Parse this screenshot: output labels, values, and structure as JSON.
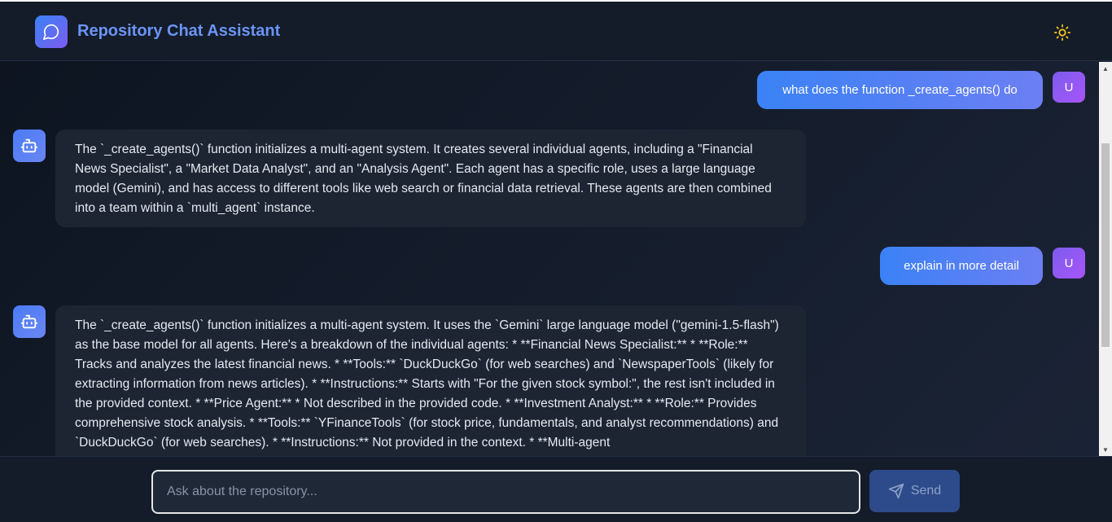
{
  "header": {
    "title": "Repository Chat Assistant",
    "theme_toggle_icon": "sun-icon"
  },
  "messages": [
    {
      "role": "user",
      "avatar": "U",
      "text": "what does the function _create_agents() do"
    },
    {
      "role": "assistant",
      "text": "The `_create_agents()` function initializes a multi-agent system. It creates several individual agents, including a \"Financial News Specialist\", a \"Market Data Analyst\", and an \"Analysis Agent\". Each agent has a specific role, uses a large language model (Gemini), and has access to different tools like web search or financial data retrieval. These agents are then combined into a team within a `multi_agent` instance."
    },
    {
      "role": "user",
      "avatar": "U",
      "text": "explain in more detail"
    },
    {
      "role": "assistant",
      "text": "The `_create_agents()` function initializes a multi-agent system. It uses the `Gemini` large language model (\"gemini-1.5-flash\") as the base model for all agents. Here's a breakdown of the individual agents: * **Financial News Specialist:** * **Role:** Tracks and analyzes the latest financial news. * **Tools:** `DuckDuckGo` (for web searches) and `NewspaperTools` (likely for extracting information from news articles). * **Instructions:** Starts with \"For the given stock symbol:\", the rest isn't included in the provided context. * **Price Agent:** * Not described in the provided code. * **Investment Analyst:** * **Role:** Provides comprehensive stock analysis. * **Tools:** `YFinanceTools` (for stock price, fundamentals, and analyst recommendations) and `DuckDuckGo` (for web searches). * **Instructions:** Not provided in the context. * **Multi-agent"
    }
  ],
  "composer": {
    "placeholder": "Ask about the repository...",
    "value": "",
    "send_label": "Send"
  },
  "colors": {
    "accent": "#3b82f6",
    "accent_purple": "#7c5cf0",
    "background": "#0f172a",
    "title": "#6a95f5",
    "sun": "#f5c518"
  }
}
